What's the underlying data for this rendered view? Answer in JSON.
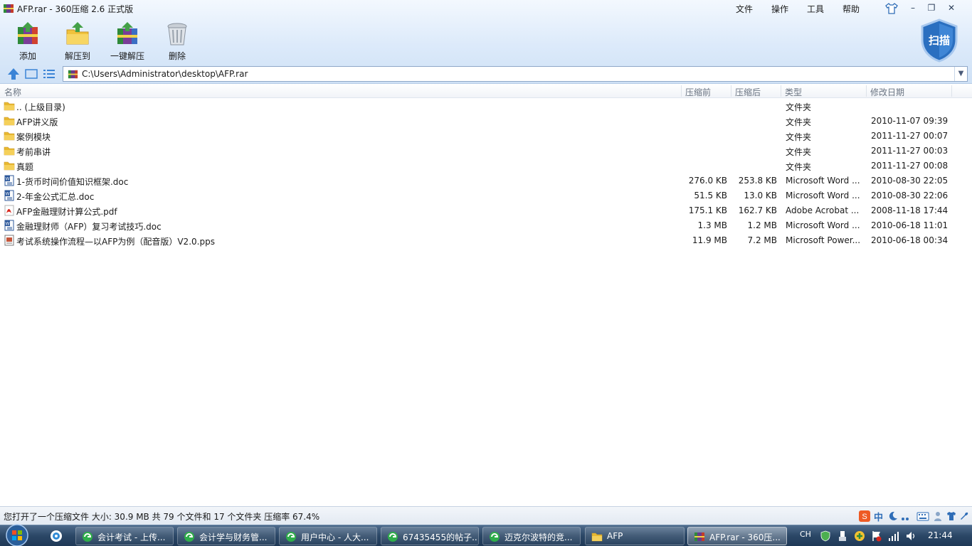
{
  "window": {
    "title": "AFP.rar - 360压缩 2.6 正式版",
    "menus": [
      "文件",
      "操作",
      "工具",
      "帮助"
    ],
    "controls": {
      "minimize": "–",
      "restore": "❐",
      "close": "✕"
    }
  },
  "toolbar": {
    "add_label": "添加",
    "extract_to_label": "解压到",
    "one_click_label": "一键解压",
    "delete_label": "删除",
    "scan_label": "扫描"
  },
  "address": {
    "path": "C:\\Users\\Administrator\\desktop\\AFP.rar",
    "dropdown": "▼"
  },
  "columns": {
    "name": "名称",
    "before": "压缩前",
    "after": "压缩后",
    "type": "类型",
    "modified": "修改日期"
  },
  "files": [
    {
      "icon": "folder",
      "name": ".. (上级目录)",
      "before": "",
      "after": "",
      "type": "文件夹",
      "modified": ""
    },
    {
      "icon": "folder",
      "name": "AFP讲义版",
      "before": "",
      "after": "",
      "type": "文件夹",
      "modified": "2010-11-07 09:39"
    },
    {
      "icon": "folder",
      "name": "案例模块",
      "before": "",
      "after": "",
      "type": "文件夹",
      "modified": "2011-11-27 00:07"
    },
    {
      "icon": "folder",
      "name": "考前串讲",
      "before": "",
      "after": "",
      "type": "文件夹",
      "modified": "2011-11-27 00:03"
    },
    {
      "icon": "folder",
      "name": "真题",
      "before": "",
      "after": "",
      "type": "文件夹",
      "modified": "2011-11-27 00:08"
    },
    {
      "icon": "word",
      "name": "1-货币时间价值知识框架.doc",
      "before": "276.0 KB",
      "after": "253.8 KB",
      "type": "Microsoft Word ...",
      "modified": "2010-08-30 22:05"
    },
    {
      "icon": "word",
      "name": "2-年金公式汇总.doc",
      "before": "51.5 KB",
      "after": "13.0 KB",
      "type": "Microsoft Word ...",
      "modified": "2010-08-30 22:06"
    },
    {
      "icon": "pdf",
      "name": "AFP金融理财计算公式.pdf",
      "before": "175.1 KB",
      "after": "162.7 KB",
      "type": "Adobe Acrobat ...",
      "modified": "2008-11-18 17:44"
    },
    {
      "icon": "word",
      "name": "金融理财师（AFP）复习考试技巧.doc",
      "before": "1.3 MB",
      "after": "1.2 MB",
      "type": "Microsoft Word ...",
      "modified": "2010-06-18 11:01"
    },
    {
      "icon": "pps",
      "name": "考试系统操作流程—以AFP为例（配音版）V2.0.pps",
      "before": "11.9 MB",
      "after": "7.2 MB",
      "type": "Microsoft Power...",
      "modified": "2010-06-18 00:34"
    }
  ],
  "status": {
    "text": "您打开了一个压缩文件 大小: 30.9 MB 共 79 个文件和 17 个文件夹 压缩率 67.4%",
    "ime_char": "中"
  },
  "taskbar": {
    "items": [
      {
        "label": "会计考试 - 上传...",
        "icon": "browser",
        "active": false
      },
      {
        "label": "会计学与财务管...",
        "icon": "browser",
        "active": false
      },
      {
        "label": "用户中心 - 人大...",
        "icon": "browser",
        "active": false
      },
      {
        "label": "67435455的帖子...",
        "icon": "browser",
        "active": false
      },
      {
        "label": "迈克尔波特的竞...",
        "icon": "browser",
        "active": false
      },
      {
        "label": "AFP",
        "icon": "folder",
        "active": false
      },
      {
        "label": "AFP.rar - 360压...",
        "icon": "archive",
        "active": true
      }
    ],
    "lang": "CH",
    "clock": "21:44"
  },
  "colors": {
    "accent": "#2f6db7",
    "folder": "#e8b830",
    "word": "#2b579a",
    "pdf": "#d9261c"
  }
}
